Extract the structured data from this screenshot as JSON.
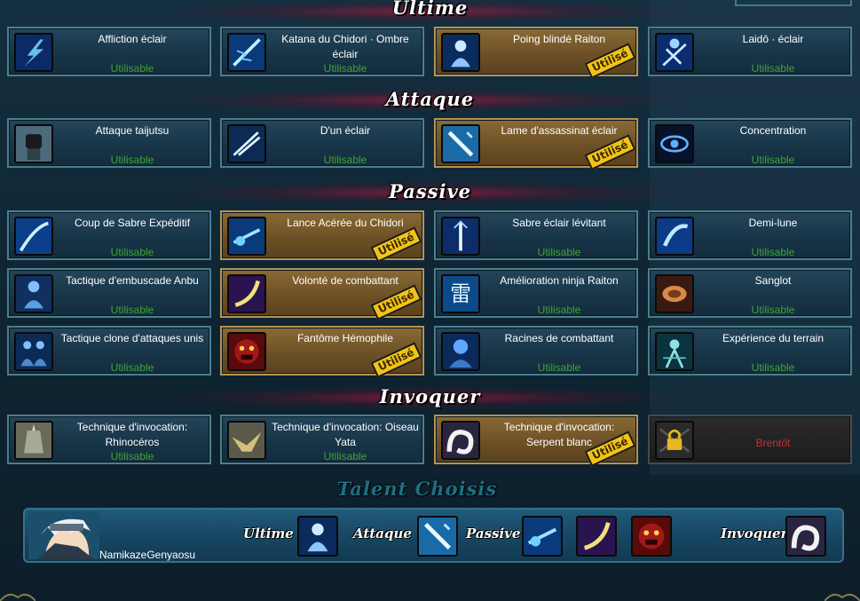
{
  "sections": {
    "ultime": "Ultime",
    "attaque": "Attaque",
    "passive": "Passive",
    "invoquer": "Invoquer"
  },
  "cards": {
    "ultime": [
      {
        "name": "Affliction éclair",
        "status": "Utilisable",
        "icon": "lightning-slash-icon"
      },
      {
        "name": "Katana du Chidori · Ombre éclair",
        "status": "Utilisable",
        "icon": "lightning-blade-icon"
      },
      {
        "name": "Poing blindé Raiton",
        "stamp": "Utilisé",
        "icon": "armored-fist-icon"
      },
      {
        "name": "Laidō · éclair",
        "status": "Utilisable",
        "icon": "iaido-icon"
      }
    ],
    "attaque": [
      {
        "name": "Attaque taijutsu",
        "status": "Utilisable",
        "icon": "fist-icon"
      },
      {
        "name": "D'un éclair",
        "status": "Utilisable",
        "icon": "flash-strike-icon"
      },
      {
        "name": "Lame d'assassinat éclair",
        "stamp": "Utilisé",
        "icon": "assassin-blade-icon"
      },
      {
        "name": "Concentration",
        "status": "Utilisable",
        "icon": "eye-icon"
      }
    ],
    "passive": [
      {
        "name": "Coup de Sabre Expéditif",
        "status": "Utilisable",
        "icon": "sword-slash-icon"
      },
      {
        "name": "Lance Acérée du Chidori",
        "stamp": "Utilisé",
        "icon": "chidori-spear-icon"
      },
      {
        "name": "Sabre éclair lévitant",
        "status": "Utilisable",
        "icon": "levitating-sword-icon"
      },
      {
        "name": "Demi-lune",
        "status": "Utilisable",
        "icon": "half-moon-icon"
      },
      {
        "name": "Tactique d'embuscade Anbu",
        "status": "Utilisable",
        "icon": "anbu-icon"
      },
      {
        "name": "Volonté de combattant",
        "stamp": "Utilisé",
        "icon": "crescent-slash-icon"
      },
      {
        "name": "Amélioration ninja Raiton",
        "status": "Utilisable",
        "icon": "raiton-kanji-icon"
      },
      {
        "name": "Sanglot",
        "status": "Utilisable",
        "icon": "scroll-icon"
      },
      {
        "name": "Tactique clone d'attaques unis",
        "status": "Utilisable",
        "icon": "clones-icon"
      },
      {
        "name": "Fantôme Hémophile",
        "stamp": "Utilisé",
        "icon": "demon-face-icon"
      },
      {
        "name": "Racines de combattant",
        "status": "Utilisable",
        "icon": "fighter-roots-icon"
      },
      {
        "name": "Expérience du terrain",
        "status": "Utilisable",
        "icon": "terrain-icon"
      }
    ],
    "invoquer": [
      {
        "name": "Technique d'invocation: Rhinocéros",
        "status": "Utilisable",
        "icon": "rhino-icon"
      },
      {
        "name": "Technique d'invocation: Oiseau Yata",
        "status": "Utilisable",
        "icon": "yata-bird-icon"
      },
      {
        "name": "Technique d'invocation: Serpent blanc",
        "stamp": "Utilisé",
        "icon": "white-snake-icon"
      },
      {
        "name": "",
        "status": "Brentôt",
        "locked": true,
        "icon": "padlock-icon"
      }
    ]
  },
  "talent": {
    "title": "Talent Choisis",
    "player_name": "NamikazeGenyaosu",
    "labels": {
      "ultime": "Ultime",
      "attaque": "Attaque",
      "passive": "Passive",
      "invoquer": "Invoquer"
    }
  },
  "colors": {
    "usable_green": "#3fa23b",
    "locked_red": "#d42b2b",
    "stamp_yellow": "#f2c317",
    "used_card": "#7a5c2e",
    "card_blue": "#1c3c50"
  }
}
